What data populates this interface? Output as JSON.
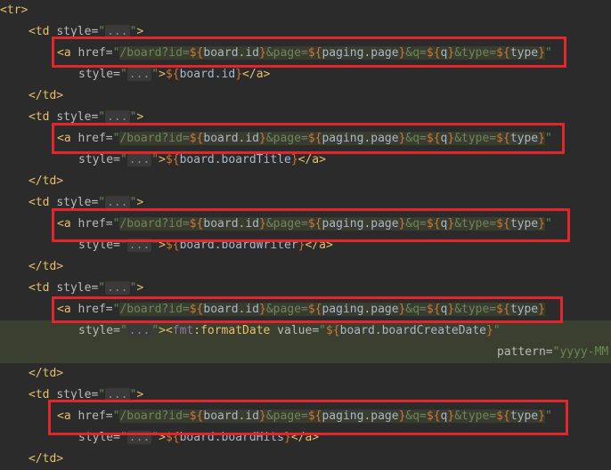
{
  "tokens": {
    "tr_open": "<tr>",
    "td_open_a": "<td ",
    "style_attr": "style=",
    "quote": "\"",
    "fold": "...",
    "gt": ">",
    "a_open": "<a ",
    "href_attr": "href=",
    "href_path": "/board?id=",
    "dollar_open": "${",
    "close_brace": "}",
    "board_id": "board.id",
    "amp_page": "&page=",
    "paging_page": "paging.page",
    "amp_q": "&q=",
    "q": "q",
    "amp_type": "&type=",
    "type": "type",
    "a_close": "</a>",
    "td_close": "</td>",
    "fmt_open": "<",
    "fmt_ns": "fmt",
    "colon": ":",
    "fmt_fn": "formatDate",
    "value_attr": " value=",
    "board_create": "board.boardCreateDate",
    "pattern_attr": "pattern=",
    "pattern_val": "\"yyyy-MM"
  },
  "cells": [
    {
      "var": "board.id"
    },
    {
      "var": "board.boardTitle"
    },
    {
      "var": "board.boardWriter"
    },
    {
      "var": "fmt:formatDate"
    },
    {
      "var": "board.boardHits"
    }
  ]
}
